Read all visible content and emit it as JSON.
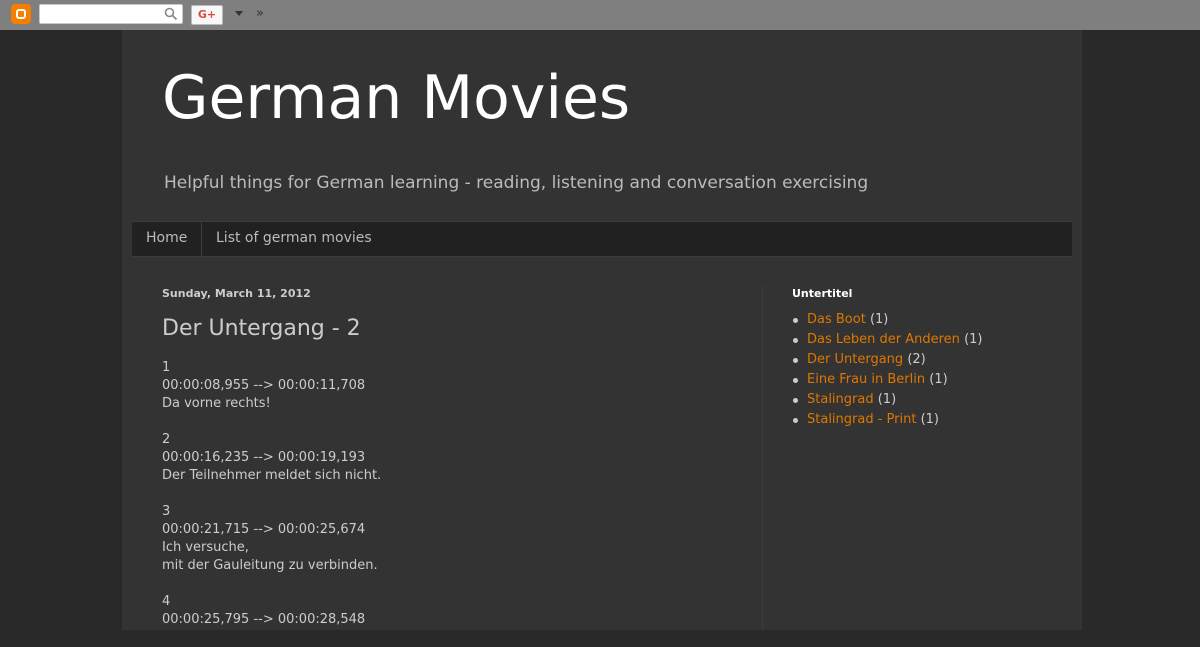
{
  "navbar": {
    "search_placeholder": "",
    "gplus_label": "G+",
    "more_label": "»"
  },
  "blog": {
    "title": "German Movies",
    "description": "Helpful things for German learning - reading, listening and conversation exercising"
  },
  "tabs": [
    {
      "label": "Home"
    },
    {
      "label": "List of german movies"
    }
  ],
  "post": {
    "date": "Sunday, March 11, 2012",
    "title": "Der Untergang - 2",
    "subtitles": [
      {
        "index": "1",
        "time": "00:00:08,955 --> 00:00:11,708",
        "lines": [
          "Da vorne rechts!"
        ]
      },
      {
        "index": "2",
        "time": "00:00:16,235 --> 00:00:19,193",
        "lines": [
          "Der Teilnehmer meldet sich nicht."
        ]
      },
      {
        "index": "3",
        "time": "00:00:21,715 --> 00:00:25,674",
        "lines": [
          "Ich versuche,",
          "mit der Gauleitung zu verbinden."
        ]
      },
      {
        "index": "4",
        "time": "00:00:25,795 --> 00:00:28,548",
        "lines": []
      }
    ]
  },
  "sidebar": {
    "title": "Untertitel",
    "labels": [
      {
        "name": "Das Boot",
        "count": "(1)"
      },
      {
        "name": "Das Leben der Anderen",
        "count": "(1)"
      },
      {
        "name": "Der Untergang",
        "count": "(2)"
      },
      {
        "name": "Eine Frau in Berlin",
        "count": "(1)"
      },
      {
        "name": "Stalingrad",
        "count": "(1)"
      },
      {
        "name": "Stalingrad - Print",
        "count": "(1)"
      }
    ]
  },
  "colors": {
    "link": "#dd7700",
    "background": "#292929",
    "content_background": "#333333",
    "navbar": "#7f7f7f"
  }
}
